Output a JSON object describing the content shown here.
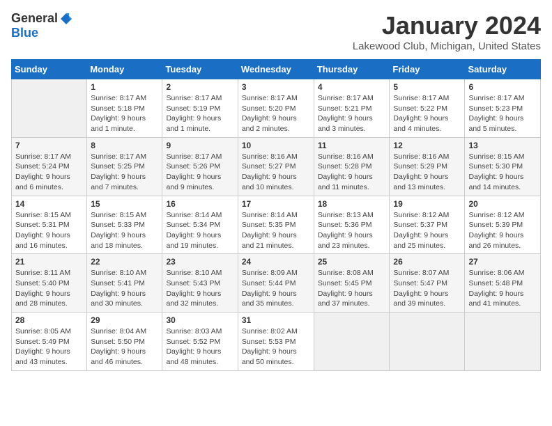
{
  "header": {
    "logo_general": "General",
    "logo_blue": "Blue",
    "month_title": "January 2024",
    "location": "Lakewood Club, Michigan, United States"
  },
  "days_of_week": [
    "Sunday",
    "Monday",
    "Tuesday",
    "Wednesday",
    "Thursday",
    "Friday",
    "Saturday"
  ],
  "weeks": [
    [
      {
        "num": "",
        "sunrise": "",
        "sunset": "",
        "daylight": "",
        "empty": true
      },
      {
        "num": "1",
        "sunrise": "Sunrise: 8:17 AM",
        "sunset": "Sunset: 5:18 PM",
        "daylight": "Daylight: 9 hours and 1 minute."
      },
      {
        "num": "2",
        "sunrise": "Sunrise: 8:17 AM",
        "sunset": "Sunset: 5:19 PM",
        "daylight": "Daylight: 9 hours and 1 minute."
      },
      {
        "num": "3",
        "sunrise": "Sunrise: 8:17 AM",
        "sunset": "Sunset: 5:20 PM",
        "daylight": "Daylight: 9 hours and 2 minutes."
      },
      {
        "num": "4",
        "sunrise": "Sunrise: 8:17 AM",
        "sunset": "Sunset: 5:21 PM",
        "daylight": "Daylight: 9 hours and 3 minutes."
      },
      {
        "num": "5",
        "sunrise": "Sunrise: 8:17 AM",
        "sunset": "Sunset: 5:22 PM",
        "daylight": "Daylight: 9 hours and 4 minutes."
      },
      {
        "num": "6",
        "sunrise": "Sunrise: 8:17 AM",
        "sunset": "Sunset: 5:23 PM",
        "daylight": "Daylight: 9 hours and 5 minutes."
      }
    ],
    [
      {
        "num": "7",
        "sunrise": "Sunrise: 8:17 AM",
        "sunset": "Sunset: 5:24 PM",
        "daylight": "Daylight: 9 hours and 6 minutes."
      },
      {
        "num": "8",
        "sunrise": "Sunrise: 8:17 AM",
        "sunset": "Sunset: 5:25 PM",
        "daylight": "Daylight: 9 hours and 7 minutes."
      },
      {
        "num": "9",
        "sunrise": "Sunrise: 8:17 AM",
        "sunset": "Sunset: 5:26 PM",
        "daylight": "Daylight: 9 hours and 9 minutes."
      },
      {
        "num": "10",
        "sunrise": "Sunrise: 8:16 AM",
        "sunset": "Sunset: 5:27 PM",
        "daylight": "Daylight: 9 hours and 10 minutes."
      },
      {
        "num": "11",
        "sunrise": "Sunrise: 8:16 AM",
        "sunset": "Sunset: 5:28 PM",
        "daylight": "Daylight: 9 hours and 11 minutes."
      },
      {
        "num": "12",
        "sunrise": "Sunrise: 8:16 AM",
        "sunset": "Sunset: 5:29 PM",
        "daylight": "Daylight: 9 hours and 13 minutes."
      },
      {
        "num": "13",
        "sunrise": "Sunrise: 8:15 AM",
        "sunset": "Sunset: 5:30 PM",
        "daylight": "Daylight: 9 hours and 14 minutes."
      }
    ],
    [
      {
        "num": "14",
        "sunrise": "Sunrise: 8:15 AM",
        "sunset": "Sunset: 5:31 PM",
        "daylight": "Daylight: 9 hours and 16 minutes."
      },
      {
        "num": "15",
        "sunrise": "Sunrise: 8:15 AM",
        "sunset": "Sunset: 5:33 PM",
        "daylight": "Daylight: 9 hours and 18 minutes."
      },
      {
        "num": "16",
        "sunrise": "Sunrise: 8:14 AM",
        "sunset": "Sunset: 5:34 PM",
        "daylight": "Daylight: 9 hours and 19 minutes."
      },
      {
        "num": "17",
        "sunrise": "Sunrise: 8:14 AM",
        "sunset": "Sunset: 5:35 PM",
        "daylight": "Daylight: 9 hours and 21 minutes."
      },
      {
        "num": "18",
        "sunrise": "Sunrise: 8:13 AM",
        "sunset": "Sunset: 5:36 PM",
        "daylight": "Daylight: 9 hours and 23 minutes."
      },
      {
        "num": "19",
        "sunrise": "Sunrise: 8:12 AM",
        "sunset": "Sunset: 5:37 PM",
        "daylight": "Daylight: 9 hours and 25 minutes."
      },
      {
        "num": "20",
        "sunrise": "Sunrise: 8:12 AM",
        "sunset": "Sunset: 5:39 PM",
        "daylight": "Daylight: 9 hours and 26 minutes."
      }
    ],
    [
      {
        "num": "21",
        "sunrise": "Sunrise: 8:11 AM",
        "sunset": "Sunset: 5:40 PM",
        "daylight": "Daylight: 9 hours and 28 minutes."
      },
      {
        "num": "22",
        "sunrise": "Sunrise: 8:10 AM",
        "sunset": "Sunset: 5:41 PM",
        "daylight": "Daylight: 9 hours and 30 minutes."
      },
      {
        "num": "23",
        "sunrise": "Sunrise: 8:10 AM",
        "sunset": "Sunset: 5:43 PM",
        "daylight": "Daylight: 9 hours and 32 minutes."
      },
      {
        "num": "24",
        "sunrise": "Sunrise: 8:09 AM",
        "sunset": "Sunset: 5:44 PM",
        "daylight": "Daylight: 9 hours and 35 minutes."
      },
      {
        "num": "25",
        "sunrise": "Sunrise: 8:08 AM",
        "sunset": "Sunset: 5:45 PM",
        "daylight": "Daylight: 9 hours and 37 minutes."
      },
      {
        "num": "26",
        "sunrise": "Sunrise: 8:07 AM",
        "sunset": "Sunset: 5:47 PM",
        "daylight": "Daylight: 9 hours and 39 minutes."
      },
      {
        "num": "27",
        "sunrise": "Sunrise: 8:06 AM",
        "sunset": "Sunset: 5:48 PM",
        "daylight": "Daylight: 9 hours and 41 minutes."
      }
    ],
    [
      {
        "num": "28",
        "sunrise": "Sunrise: 8:05 AM",
        "sunset": "Sunset: 5:49 PM",
        "daylight": "Daylight: 9 hours and 43 minutes."
      },
      {
        "num": "29",
        "sunrise": "Sunrise: 8:04 AM",
        "sunset": "Sunset: 5:50 PM",
        "daylight": "Daylight: 9 hours and 46 minutes."
      },
      {
        "num": "30",
        "sunrise": "Sunrise: 8:03 AM",
        "sunset": "Sunset: 5:52 PM",
        "daylight": "Daylight: 9 hours and 48 minutes."
      },
      {
        "num": "31",
        "sunrise": "Sunrise: 8:02 AM",
        "sunset": "Sunset: 5:53 PM",
        "daylight": "Daylight: 9 hours and 50 minutes."
      },
      {
        "num": "",
        "sunrise": "",
        "sunset": "",
        "daylight": "",
        "empty": true
      },
      {
        "num": "",
        "sunrise": "",
        "sunset": "",
        "daylight": "",
        "empty": true
      },
      {
        "num": "",
        "sunrise": "",
        "sunset": "",
        "daylight": "",
        "empty": true
      }
    ]
  ]
}
